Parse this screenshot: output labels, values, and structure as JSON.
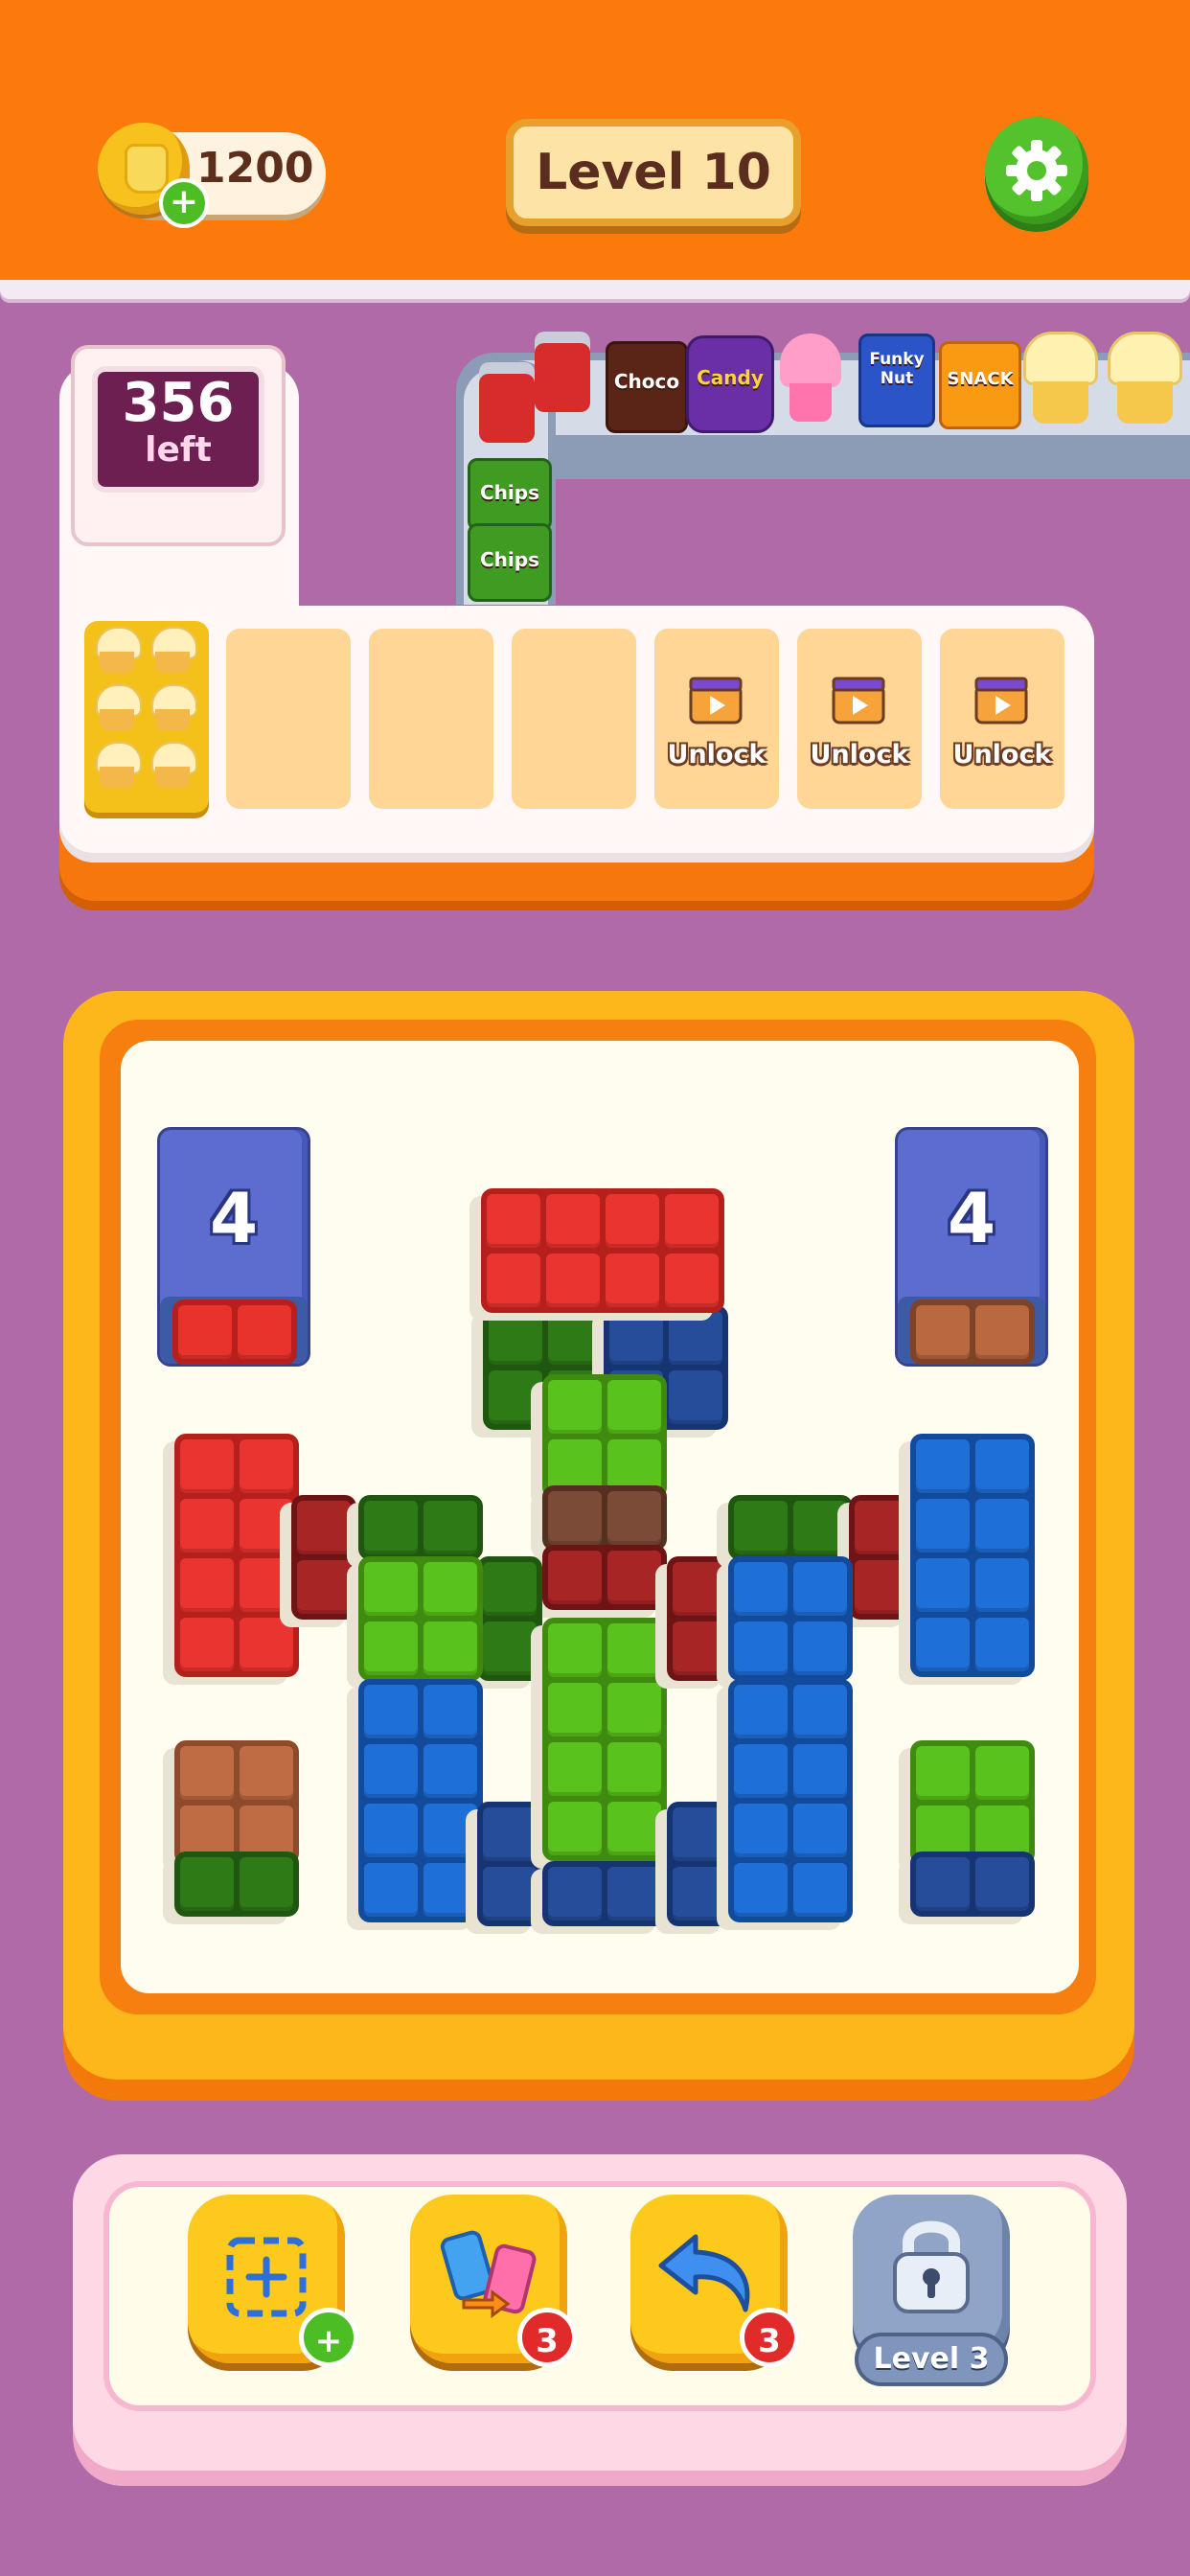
{
  "header": {
    "coins": "1200",
    "level": "Level 10",
    "colors": {
      "header_bg": "#fb7a0b",
      "page_bg": "#b06aa8"
    }
  },
  "counter": {
    "count": "356",
    "label": "left"
  },
  "conveyor": {
    "snacks": [
      {
        "icon": "soda-can-icon"
      },
      {
        "icon": "soda-can-icon"
      },
      {
        "icon": "chips-bag-icon",
        "label": "Chips"
      },
      {
        "icon": "chips-bag-icon",
        "label": "Chips"
      },
      {
        "icon": "choco-bag-icon",
        "label": "Choco"
      },
      {
        "icon": "candy-jar-icon",
        "label": "Candy"
      },
      {
        "icon": "cupcake-icon"
      },
      {
        "icon": "funky-nut-bag-icon",
        "label": "Funky Nut"
      },
      {
        "icon": "snack-bag-icon",
        "label": "SNACK"
      },
      {
        "icon": "popcorn-icon"
      },
      {
        "icon": "popcorn-icon"
      }
    ]
  },
  "tray": {
    "slots": [
      {
        "state": "filled",
        "item": "muffin-tray-icon"
      },
      {
        "state": "empty"
      },
      {
        "state": "empty"
      },
      {
        "state": "empty"
      },
      {
        "state": "locked",
        "label": "Unlock"
      },
      {
        "state": "locked",
        "label": "Unlock"
      },
      {
        "state": "locked",
        "label": "Unlock"
      }
    ]
  },
  "board": {
    "queue_boxes": [
      {
        "position": "left",
        "count": "4",
        "next_color": "#e8332d"
      },
      {
        "position": "right",
        "count": "4",
        "next_color": "#b9683f"
      }
    ],
    "colors": {
      "red": "#ea3430",
      "dark_red": "#a82526",
      "green": "#5ac21c",
      "dark_green": "#2e7a16",
      "blue": "#1f6fd8",
      "dark_blue": "#254d9a",
      "brown": "#bf6b44",
      "dark_brown": "#7b4b38"
    }
  },
  "toolbar": {
    "tools": [
      {
        "icon": "add-slot-icon",
        "badge": "+"
      },
      {
        "icon": "shuffle-icon",
        "badge": "3"
      },
      {
        "icon": "undo-icon",
        "badge": "3"
      },
      {
        "icon": "lock-icon",
        "label": "Level 3"
      }
    ]
  }
}
